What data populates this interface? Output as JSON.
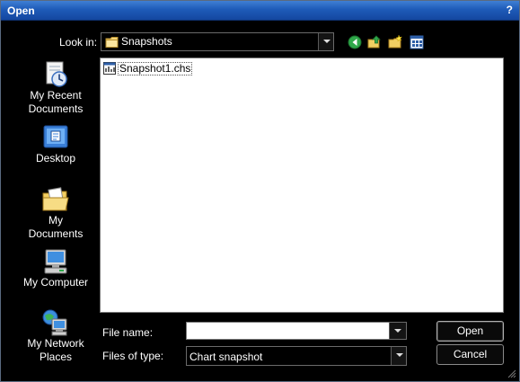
{
  "window": {
    "title": "Open",
    "help_label": "?"
  },
  "lookin": {
    "label": "Look in:",
    "value": "Snapshots"
  },
  "toolbar": {
    "icons": [
      "back-icon",
      "up-folder-icon",
      "new-folder-icon",
      "view-menu-icon"
    ]
  },
  "places": [
    {
      "label_line1": "My Recent",
      "label_line2": "Documents",
      "icon": "recent-documents-icon"
    },
    {
      "label_line1": "Desktop",
      "label_line2": "",
      "icon": "desktop-icon"
    },
    {
      "label_line1": "My",
      "label_line2": "Documents",
      "icon": "my-documents-icon"
    },
    {
      "label_line1": "My Computer",
      "label_line2": "",
      "icon": "my-computer-icon"
    },
    {
      "label_line1": "My Network",
      "label_line2": "Places",
      "icon": "network-places-icon"
    }
  ],
  "files": [
    {
      "name": "Snapshot1.chs",
      "icon": "chart-file-icon"
    }
  ],
  "filename": {
    "label": "File name:",
    "value": ""
  },
  "filetype": {
    "label": "Files of type:",
    "value": "Chart snapshot"
  },
  "buttons": {
    "open": "Open",
    "cancel": "Cancel"
  },
  "colors": {
    "titlebar": "#1e5bb8",
    "background": "#000000",
    "list_bg": "#ffffff"
  }
}
